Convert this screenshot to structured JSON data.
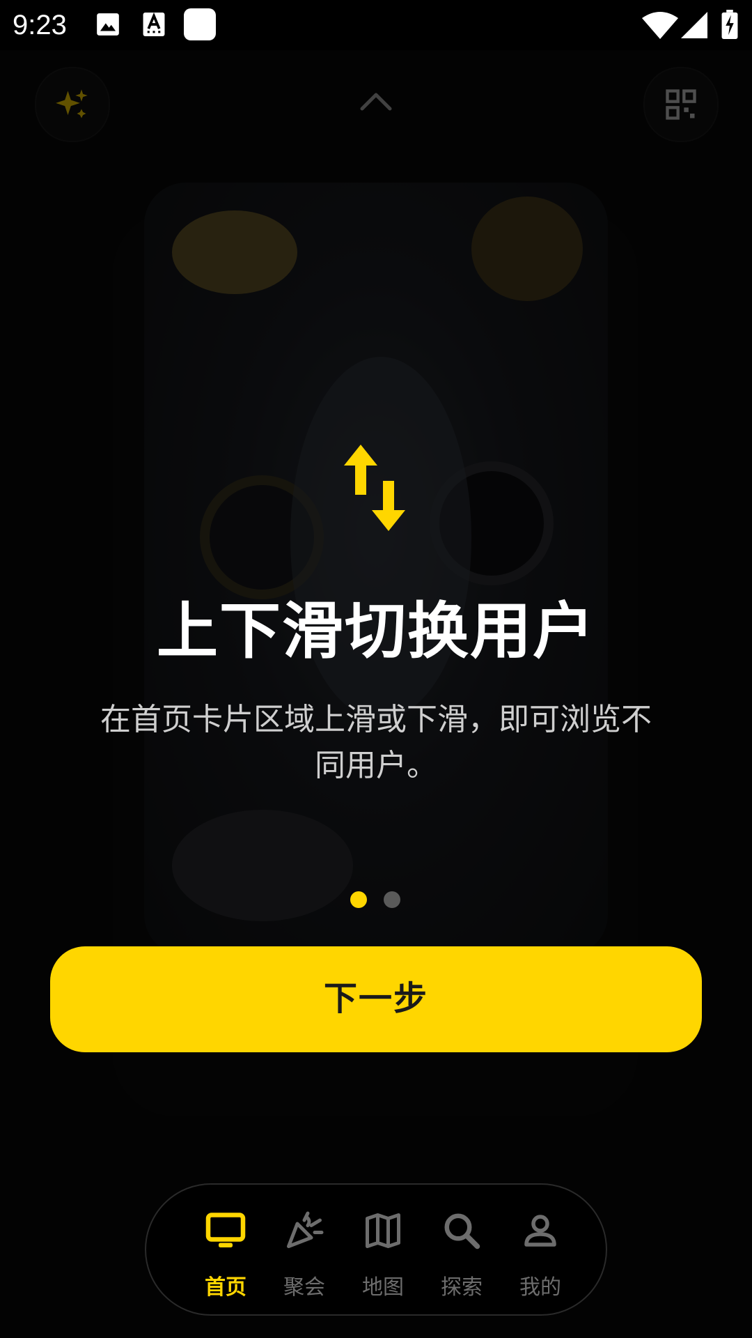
{
  "status_bar": {
    "time": "9:23",
    "icons": [
      "gallery-icon",
      "a-keyboard-icon",
      "app-square-icon",
      "wifi-icon",
      "signal-icon",
      "battery-charging-icon"
    ]
  },
  "top_bar": {
    "left_icon": "sparkle-icon",
    "center_icon": "chevron-up-icon",
    "right_icon": "qr-scan-icon"
  },
  "guide": {
    "icon": "swap-vertical-icon",
    "title": "上下滑切换用户",
    "description": "在首页卡片区域上滑或下滑，即可浏览不同用户。",
    "pager": {
      "current": 1,
      "total": 2
    },
    "next_button_label": "下一步"
  },
  "tabbar": {
    "items": [
      {
        "label": "首页",
        "icon": "tv-icon",
        "active": true
      },
      {
        "label": "聚会",
        "icon": "party-popper-icon",
        "active": false
      },
      {
        "label": "地图",
        "icon": "map-icon",
        "active": false
      },
      {
        "label": "探索",
        "icon": "search-icon",
        "active": false
      },
      {
        "label": "我的",
        "icon": "person-icon",
        "active": false
      }
    ]
  },
  "colors": {
    "accent": "#ffd600",
    "background": "#000000",
    "inactive_tab": "#6d6d6d",
    "text_primary": "#ffffff",
    "text_secondary": "#cfcfcf"
  }
}
